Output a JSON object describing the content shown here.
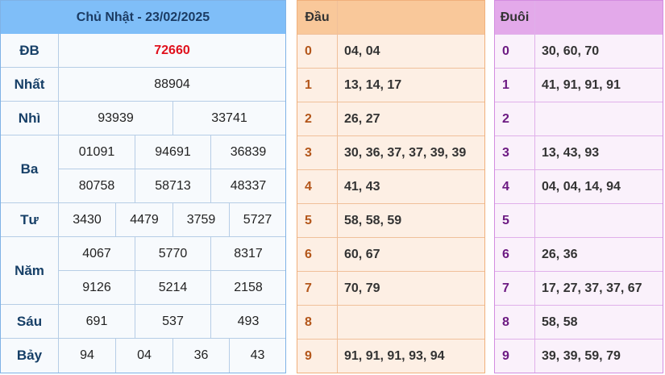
{
  "results": {
    "date_header": "Chủ Nhật - 23/02/2025",
    "rows": {
      "db": {
        "label": "ĐB",
        "values": [
          "72660"
        ]
      },
      "nhat": {
        "label": "Nhất",
        "values": [
          "88904"
        ]
      },
      "nhi": {
        "label": "Nhì",
        "values": [
          "93939",
          "33741"
        ]
      },
      "ba": {
        "label": "Ba",
        "values": [
          "01091",
          "94691",
          "36839",
          "80758",
          "58713",
          "48337"
        ]
      },
      "tu": {
        "label": "Tư",
        "values": [
          "3430",
          "4479",
          "3759",
          "5727"
        ]
      },
      "nam": {
        "label": "Năm",
        "values": [
          "4067",
          "5770",
          "8317",
          "9126",
          "5214",
          "2158"
        ]
      },
      "sau": {
        "label": "Sáu",
        "values": [
          "691",
          "537",
          "493"
        ]
      },
      "bay": {
        "label": "Bảy",
        "values": [
          "94",
          "04",
          "36",
          "43"
        ]
      }
    }
  },
  "dau": {
    "header": "Đầu",
    "rows": [
      {
        "key": "0",
        "value": "04, 04"
      },
      {
        "key": "1",
        "value": "13, 14, 17"
      },
      {
        "key": "2",
        "value": "26, 27"
      },
      {
        "key": "3",
        "value": "30, 36, 37, 37, 39, 39"
      },
      {
        "key": "4",
        "value": "41, 43"
      },
      {
        "key": "5",
        "value": "58, 58, 59"
      },
      {
        "key": "6",
        "value": "60, 67"
      },
      {
        "key": "7",
        "value": "70, 79"
      },
      {
        "key": "8",
        "value": ""
      },
      {
        "key": "9",
        "value": "91, 91, 91, 93, 94"
      }
    ]
  },
  "duoi": {
    "header": "Đuôi",
    "rows": [
      {
        "key": "0",
        "value": "30, 60, 70"
      },
      {
        "key": "1",
        "value": "41, 91, 91, 91"
      },
      {
        "key": "2",
        "value": ""
      },
      {
        "key": "3",
        "value": "13, 43, 93"
      },
      {
        "key": "4",
        "value": "04, 04, 14, 94"
      },
      {
        "key": "5",
        "value": ""
      },
      {
        "key": "6",
        "value": "26, 36"
      },
      {
        "key": "7",
        "value": "17, 27, 37, 37, 67"
      },
      {
        "key": "8",
        "value": "58, 58"
      },
      {
        "key": "9",
        "value": "39, 39, 59, 79"
      }
    ]
  },
  "colors": {
    "results_header_bg": "#7fbef8",
    "special_prize_text": "#e0101c",
    "dau_header_bg": "#f9c89a",
    "duoi_header_bg": "#e3a9ea"
  }
}
